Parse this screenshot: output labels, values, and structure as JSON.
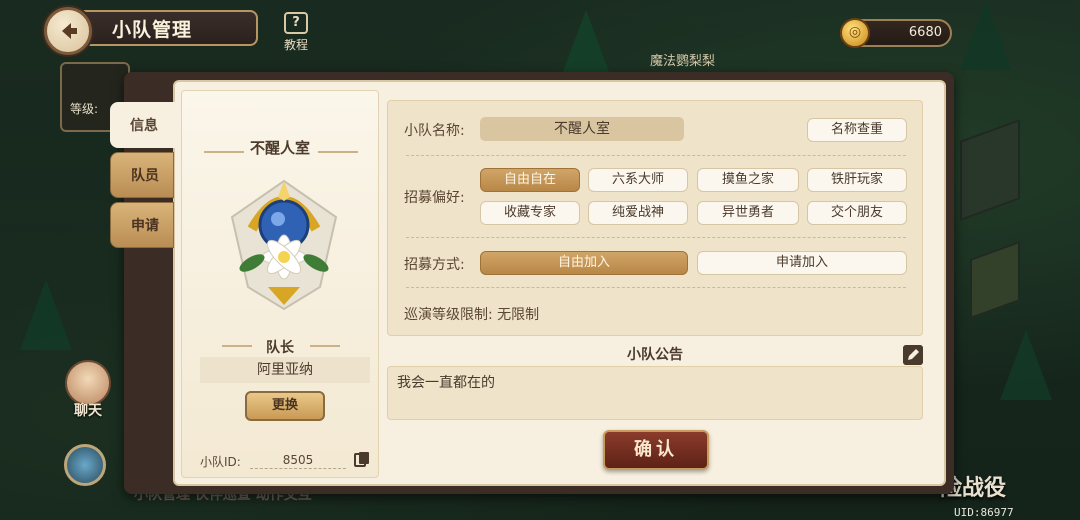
{
  "header": {
    "title": "小队管理",
    "tutorial_label": "教程",
    "tutorial_icon": "?",
    "map_label": "魔法鹦梨梨"
  },
  "currency": {
    "amount": "6680",
    "icon": "gold-coin-icon"
  },
  "hud": {
    "level_label": "等级:",
    "chat_label": "聊天",
    "adventure_label": "险战役",
    "uid": "UID:86977",
    "bottom_ghost": "小队管理  伙伴巡查  动作交互"
  },
  "tabs": [
    {
      "label": "信息"
    },
    {
      "label": "队员"
    },
    {
      "label": "申请"
    }
  ],
  "team_card": {
    "name": "不醒人室",
    "leader_label": "队长",
    "leader_name": "阿里亚纳",
    "change_label": "更换",
    "id_label": "小队ID:",
    "id_value": "8505"
  },
  "settings": {
    "name_label": "小队名称:",
    "name_value": "不醒人室",
    "rename_label": "名称查重",
    "pref_label": "招募偏好:",
    "preferences": [
      "自由自在",
      "六系大师",
      "摸鱼之家",
      "铁肝玩家",
      "收藏专家",
      "纯爱战神",
      "异世勇者",
      "交个朋友"
    ],
    "method_label": "招募方式:",
    "methods": [
      "自由加入",
      "申请加入"
    ],
    "level_limit": "巡演等级限制: 无限制"
  },
  "announcement": {
    "title": "小队公告",
    "text": "我会一直都在的"
  },
  "confirm_label": "确认",
  "colors": {
    "panel": "#f7f0e1",
    "accent": "#b88747",
    "confirm": "#6e2b1f"
  }
}
